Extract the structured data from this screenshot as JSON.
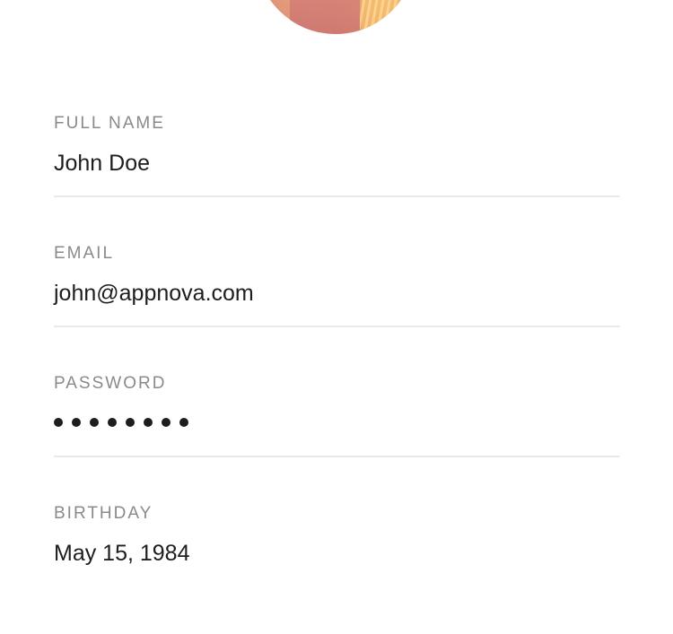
{
  "profile": {
    "avatar_icon": "profile-photo"
  },
  "fields": {
    "full_name": {
      "label": "FULL NAME",
      "value": "John Doe"
    },
    "email": {
      "label": "EMAIL",
      "value": "john@appnova.com"
    },
    "password": {
      "label": "PASSWORD",
      "masked_length": 8
    },
    "birthday": {
      "label": "BIRTHDAY",
      "value": "May 15, 1984"
    }
  }
}
